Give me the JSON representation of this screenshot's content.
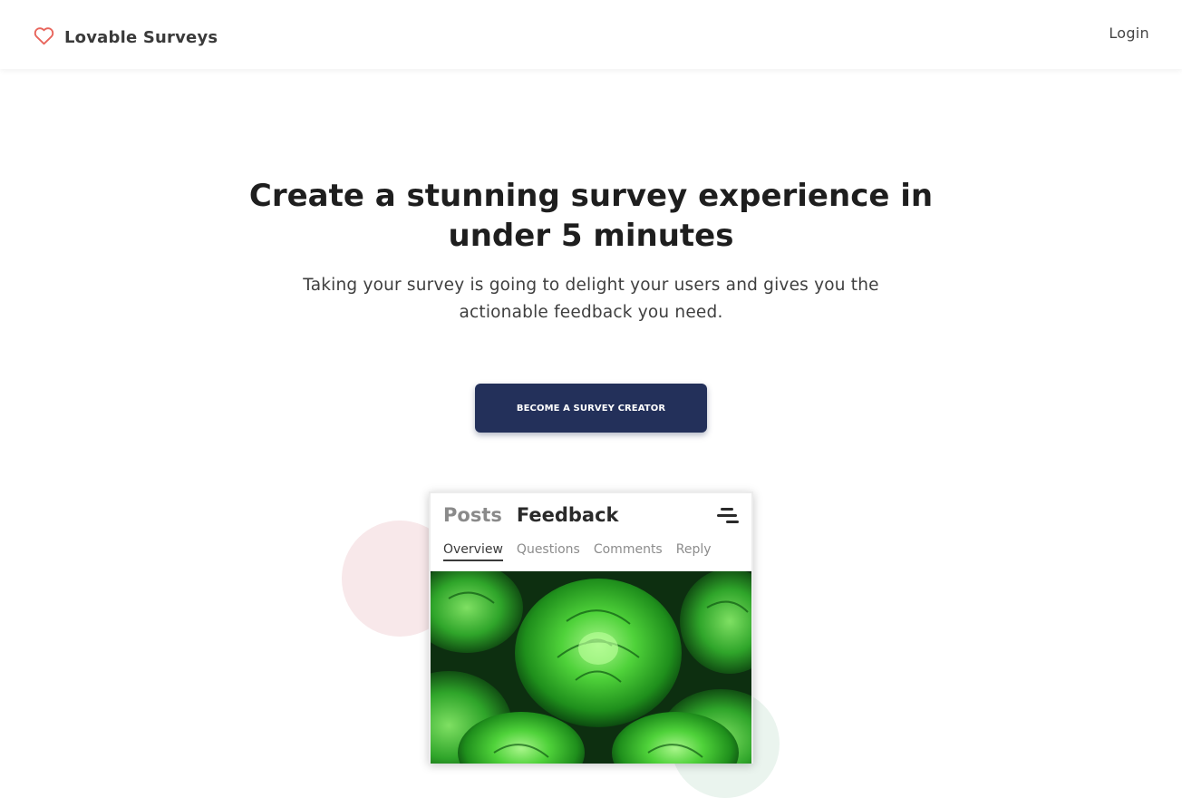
{
  "nav": {
    "brand": "Lovable Surveys",
    "login": "Login",
    "heart_color": "#e8655c"
  },
  "hero": {
    "title": "Create a stunning survey experience in under 5 minutes",
    "subtitle": "Taking your survey is going to delight your users and gives you the actionable feedback you need.",
    "cta": "BECOME A SURVEY CREATOR",
    "cta_color": "#23305a"
  },
  "mockup": {
    "posts": "Posts",
    "feedback": "Feedback",
    "tabs": [
      "Overview",
      "Questions",
      "Comments",
      "Reply"
    ],
    "active_tab": "Overview",
    "menu_icon": "menu-icon",
    "image": "green lettuce heads"
  }
}
